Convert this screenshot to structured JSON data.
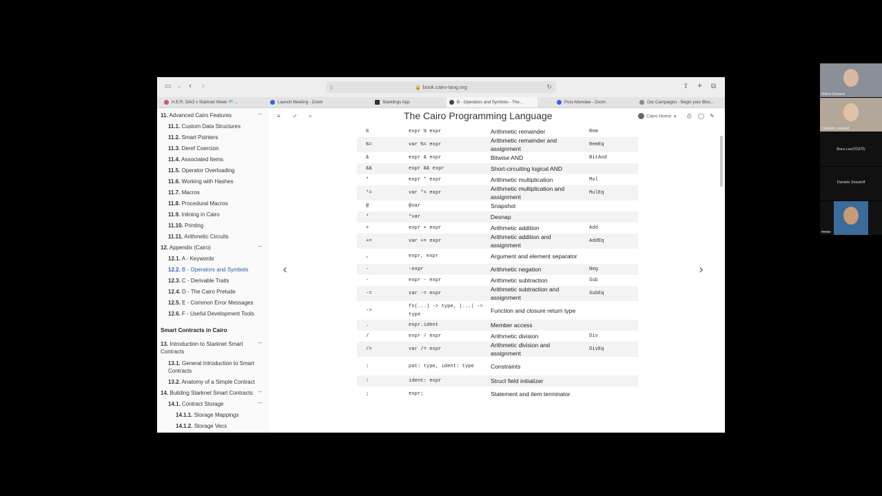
{
  "browser": {
    "url": "book.cairo-lang.org",
    "tabs": [
      {
        "label": "H.E.R. DAO x Starknet Week 🪪 ...",
        "color": "#c45a7a",
        "active": false
      },
      {
        "label": "Launch Meeting - Zoom",
        "color": "#2d6cdf",
        "active": false
      },
      {
        "label": "Starklings App",
        "color": "#333333",
        "active": false
      },
      {
        "label": "B - Operators and Symbols - The...",
        "color": "#444444",
        "active": true
      },
      {
        "label": "Post Attendee - Zoom",
        "color": "#2d6cdf",
        "active": false
      },
      {
        "label": "Our Campaigns - Begin your Bloc...",
        "color": "#888888",
        "active": false
      }
    ]
  },
  "book": {
    "title": "The Cairo Programming Language",
    "home_link": "Cairo Home"
  },
  "sidebar": {
    "items": [
      {
        "num": "11.",
        "label": "Advanced Cairo Features",
        "toggle": "–",
        "active": false
      },
      {
        "num": "11.1.",
        "label": "Custom Data Structures",
        "active": false
      },
      {
        "num": "11.2.",
        "label": "Smart Pointers",
        "active": false
      },
      {
        "num": "11.3.",
        "label": "Deref Coercion",
        "active": false
      },
      {
        "num": "11.4.",
        "label": "Associated Items",
        "active": false
      },
      {
        "num": "11.5.",
        "label": "Operator Overloading",
        "active": false
      },
      {
        "num": "11.6.",
        "label": "Working with Hashes",
        "active": false
      },
      {
        "num": "11.7.",
        "label": "Macros",
        "active": false
      },
      {
        "num": "11.8.",
        "label": "Procedural Macros",
        "active": false
      },
      {
        "num": "11.9.",
        "label": "Inlining in Cairo",
        "active": false
      },
      {
        "num": "11.10.",
        "label": "Printing",
        "active": false
      },
      {
        "num": "11.11.",
        "label": "Arithmetic Circuits",
        "active": false
      },
      {
        "num": "12.",
        "label": "Appendix (Cairo)",
        "toggle": "–",
        "active": false
      },
      {
        "num": "12.1.",
        "label": "A - Keywords",
        "active": false
      },
      {
        "num": "12.2.",
        "label": "B - Operators and Symbols",
        "active": true
      },
      {
        "num": "12.3.",
        "label": "C - Derivable Traits",
        "active": false
      },
      {
        "num": "12.4.",
        "label": "D - The Cairo Prelude",
        "active": false
      },
      {
        "num": "12.5.",
        "label": "E - Common Error Messages",
        "active": false
      },
      {
        "num": "12.6.",
        "label": "F - Useful Development Tools",
        "active": false
      },
      {
        "part": "Smart Contracts in Cairo"
      },
      {
        "num": "13.",
        "label": "Introduction to Starknet Smart",
        "label2": "Contracts",
        "toggle": "–",
        "active": false
      },
      {
        "num": "13.1.",
        "label": "General Introduction to Smart",
        "label2": "Contracts",
        "active": false
      },
      {
        "num": "13.2.",
        "label": "Anatomy of a Simple Contract",
        "active": false
      },
      {
        "num": "14.",
        "label": "Building Starknet Smart Contracts",
        "toggle": "–",
        "active": false
      },
      {
        "num": "14.1.",
        "label": "Contract Storage",
        "toggle": "–",
        "active": false
      },
      {
        "num": "14.1.1.",
        "label": "Storage Mappings",
        "active": false
      },
      {
        "num": "14.1.2.",
        "label": "Storage Vecs",
        "active": false
      }
    ]
  },
  "operators_table": {
    "rows": [
      {
        "op": "%",
        "example": "expr % expr",
        "explanation": "Arithmetic remainder",
        "trait": "Rem"
      },
      {
        "op": "%=",
        "example": "var %= expr",
        "explanation": "Arithmetic remainder and assignment",
        "trait": "RemEq"
      },
      {
        "op": "&",
        "example": "expr & expr",
        "explanation": "Bitwise AND",
        "trait": "BitAnd"
      },
      {
        "op": "&&",
        "example": "expr && expr",
        "explanation": "Short-circuiting logical AND",
        "trait": ""
      },
      {
        "op": "*",
        "example": "expr * expr",
        "explanation": "Arithmetic multiplication",
        "trait": "Mul"
      },
      {
        "op": "*=",
        "example": "var *= expr",
        "explanation": "Arithmetic multiplication and assignment",
        "trait": "MulEq"
      },
      {
        "op": "@",
        "example": "@var",
        "explanation": "Snapshot",
        "trait": ""
      },
      {
        "op": "*",
        "example": "*var",
        "explanation": "Desnap",
        "trait": ""
      },
      {
        "op": "+",
        "example": "expr + expr",
        "explanation": "Arithmetic addition",
        "trait": "Add"
      },
      {
        "op": "+=",
        "example": "var += expr",
        "explanation": "Arithmetic addition and assignment",
        "trait": "AddEq"
      },
      {
        "op": ",",
        "example": "expr, expr",
        "explanation": "Argument and element separator",
        "trait": ""
      },
      {
        "op": "-",
        "example": "-expr",
        "explanation": "Arithmetic negation",
        "trait": "Neg"
      },
      {
        "op": "-",
        "example": "expr - expr",
        "explanation": "Arithmetic subtraction",
        "trait": "Sub"
      },
      {
        "op": "-=",
        "example": "var -= expr",
        "explanation": "Arithmetic subtraction and assignment",
        "trait": "SubEq"
      },
      {
        "op": "->",
        "example": "fn(...) -> type, |...| -> type",
        "explanation": "Function and closure return type",
        "trait": ""
      },
      {
        "op": ".",
        "example": "expr.ident",
        "explanation": "Member access",
        "trait": ""
      },
      {
        "op": "/",
        "example": "expr / expr",
        "explanation": "Arithmetic division",
        "trait": "Div"
      },
      {
        "op": "/=",
        "example": "var /= expr",
        "explanation": "Arithmetic division and assignment",
        "trait": "DivEq"
      },
      {
        "op": ":",
        "example": "pat: type, ident: type",
        "explanation": "Constraints",
        "trait": ""
      },
      {
        "op": ":",
        "example": "ident: expr",
        "explanation": "Struct field initializer",
        "trait": ""
      },
      {
        "op": ";",
        "example": "expr;",
        "explanation": "Statement and item terminator",
        "trait": ""
      }
    ]
  },
  "participants": [
    {
      "name": "Soline Daviaud",
      "has_video": true,
      "skin": "#d9b9a0",
      "bg": "#8a8f98"
    },
    {
      "name": "Charlotte Leonard",
      "has_video": true,
      "skin": "#e0c2a8",
      "bg": "#b3a79a"
    },
    {
      "name": "Bora Lee(이보라)",
      "has_video": false
    },
    {
      "name": "Daniele Zeissloff",
      "has_video": false
    },
    {
      "name": "mews-",
      "has_video": true,
      "skin": "#c79a78",
      "bg": "#3a6b9a"
    }
  ],
  "icons": {
    "sidebar_toggle": "sidebar-icon",
    "back": "chevron-left-icon",
    "forward": "chevron-right-icon",
    "share": "share-icon",
    "new_tab": "plus-icon",
    "tabs_overview": "tabs-icon",
    "menu": "hamburger-icon",
    "theme": "brush-icon",
    "search": "search-icon",
    "print": "print-icon",
    "github": "github-icon",
    "edit": "edit-icon",
    "prev": "prev-chapter-icon",
    "next": "next-chapter-icon"
  }
}
